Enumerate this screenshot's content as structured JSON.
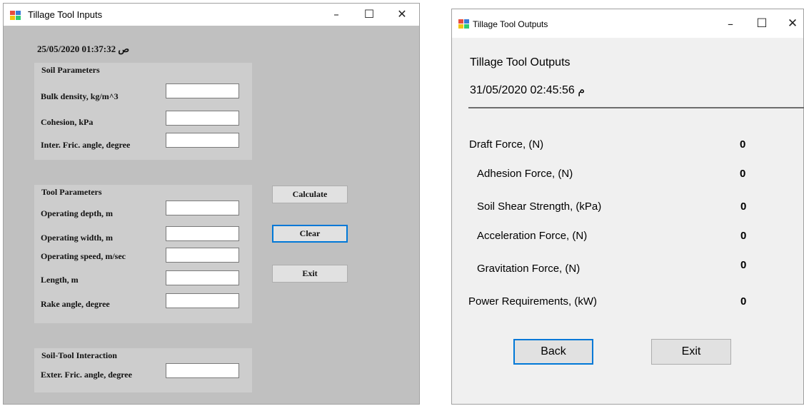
{
  "inputs_window": {
    "title": "Tillage Tool Inputs",
    "timestamp": "25/05/2020 01:37:32 ص",
    "controls": {
      "minimize": "–",
      "maximize": "☐",
      "close": "✕"
    },
    "soil_parameters": {
      "title": "Soil Parameters",
      "fields": [
        {
          "label": "Bulk density, kg/m^3",
          "value": ""
        },
        {
          "label": "Cohesion, kPa",
          "value": ""
        },
        {
          "label": "Inter. Fric. angle, degree",
          "value": ""
        }
      ]
    },
    "tool_parameters": {
      "title": "Tool Parameters",
      "fields": [
        {
          "label": "Operating depth, m",
          "value": ""
        },
        {
          "label": "Operating width, m",
          "value": ""
        },
        {
          "label": "Operating speed, m/sec",
          "value": ""
        },
        {
          "label": "Length, m",
          "value": ""
        },
        {
          "label": "Rake angle, degree",
          "value": ""
        }
      ]
    },
    "soil_tool_interaction": {
      "title": "Soil-Tool Interaction",
      "fields": [
        {
          "label": "Exter. Fric. angle, degree",
          "value": ""
        }
      ]
    },
    "buttons": {
      "calculate": "Calculate",
      "clear": "Clear",
      "exit": "Exit"
    }
  },
  "outputs_window": {
    "title": "Tillage Tool Outputs",
    "heading": "Tillage Tool Outputs",
    "timestamp": "31/05/2020 02:45:56 م",
    "controls": {
      "minimize": "–",
      "maximize": "☐",
      "close": "✕"
    },
    "results": [
      {
        "label": "Draft Force, (N)",
        "value": "0"
      },
      {
        "label": "Adhesion Force, (N)",
        "value": "0"
      },
      {
        "label": "Soil Shear Strength, (kPa)",
        "value": "0"
      },
      {
        "label": "Acceleration Force, (N)",
        "value": "0"
      },
      {
        "label": "Gravitation Force, (N)",
        "value": "0"
      },
      {
        "label": "Power Requirements, (kW)",
        "value": "0"
      }
    ],
    "buttons": {
      "back": "Back",
      "exit": "Exit"
    }
  },
  "colors": {
    "inputs_background": "#c0c0c0",
    "outputs_background": "#f0f0f0",
    "group_background": "#cdcdcd",
    "focus_border": "#0078d7"
  },
  "icons": [
    "app-icon",
    "minimize-icon",
    "maximize-icon",
    "close-icon"
  ]
}
